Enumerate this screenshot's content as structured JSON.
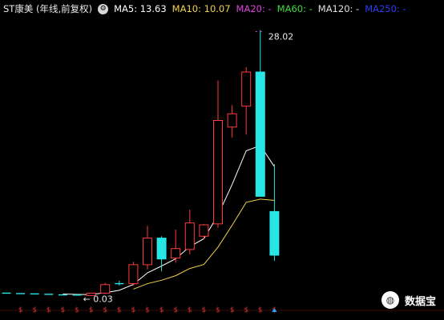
{
  "header": {
    "title": "ST康美 (年线,前复权)",
    "gear_icon": "gear-icon",
    "ma_items": [
      {
        "label": "MA5: 13.63",
        "color": "#ffffff"
      },
      {
        "label": "MA10: 10.07",
        "color": "#f2d34a"
      },
      {
        "label": "MA20: -",
        "color": "#e040e0"
      },
      {
        "label": "MA60: -",
        "color": "#3ddc3d"
      },
      {
        "label": "MA120: -",
        "color": "#e0e0e0"
      },
      {
        "label": "MA250: -",
        "color": "#2b3df2"
      }
    ]
  },
  "chart_data": {
    "type": "candlestick",
    "title": "",
    "xlabel": "",
    "ylabel": "",
    "ylim": [
      0,
      29.5
    ],
    "colors": {
      "up": "#ff3b3b",
      "down": "#29e6e6",
      "flat": "#29e6e6",
      "ma5": "#ffffff",
      "ma10": "#f2d34a"
    },
    "candles": [
      {
        "o": 0.3,
        "h": 0.3,
        "l": 0.3,
        "c": 0.3
      },
      {
        "o": 0.25,
        "h": 0.25,
        "l": 0.25,
        "c": 0.25
      },
      {
        "o": 0.22,
        "h": 0.22,
        "l": 0.22,
        "c": 0.22
      },
      {
        "o": 0.18,
        "h": 0.18,
        "l": 0.18,
        "c": 0.18
      },
      {
        "o": 0.12,
        "h": 0.12,
        "l": 0.12,
        "c": 0.12
      },
      {
        "o": 0.1,
        "h": 0.1,
        "l": 0.1,
        "c": 0.1
      },
      {
        "o": 0.05,
        "h": 0.35,
        "l": 0.03,
        "c": 0.3
      },
      {
        "o": 0.3,
        "h": 1.4,
        "l": 0.2,
        "c": 1.2
      },
      {
        "o": 1.3,
        "h": 1.6,
        "l": 1.1,
        "c": 1.3
      },
      {
        "o": 1.3,
        "h": 3.6,
        "l": 1.1,
        "c": 3.3
      },
      {
        "o": 3.3,
        "h": 7.4,
        "l": 2.8,
        "c": 6.1
      },
      {
        "o": 6.1,
        "h": 6.3,
        "l": 2.6,
        "c": 3.9
      },
      {
        "o": 4.0,
        "h": 7.0,
        "l": 3.5,
        "c": 5.0
      },
      {
        "o": 4.9,
        "h": 9.1,
        "l": 4.4,
        "c": 7.7
      },
      {
        "o": 6.3,
        "h": 7.6,
        "l": 6.0,
        "c": 7.5
      },
      {
        "o": 7.6,
        "h": 22.7,
        "l": 7.2,
        "c": 18.5
      },
      {
        "o": 17.8,
        "h": 20.1,
        "l": 16.7,
        "c": 19.2
      },
      {
        "o": 20.0,
        "h": 24.1,
        "l": 17.0,
        "c": 23.6
      },
      {
        "o": 23.6,
        "h": 28.02,
        "l": 10.8,
        "c": 10.5
      },
      {
        "o": 8.9,
        "h": 13.9,
        "l": 3.7,
        "c": 4.3
      }
    ],
    "ma5": [
      null,
      null,
      null,
      null,
      0.21,
      0.17,
      0.15,
      0.35,
      0.6,
      1.22,
      2.44,
      3.16,
      3.92,
      5.2,
      6.04,
      8.52,
      11.74,
      15.3,
      15.86,
      13.63
    ],
    "ma10": [
      null,
      null,
      null,
      null,
      null,
      null,
      null,
      null,
      null,
      0.72,
      1.3,
      1.66,
      2.14,
      2.9,
      3.32,
      5.15,
      7.45,
      9.87,
      10.21,
      10.07
    ],
    "dividend_marker": "$",
    "extreme_labels": {
      "high": "28.02",
      "low": "0.03"
    },
    "low_arrow": "←"
  },
  "watermark": {
    "icon": "wechat-icon",
    "text": "数据宝"
  }
}
